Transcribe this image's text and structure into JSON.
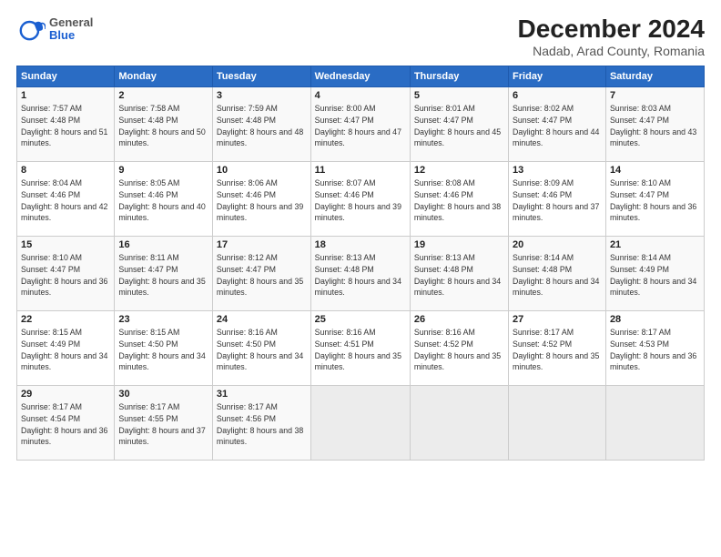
{
  "logo": {
    "general": "General",
    "blue": "Blue"
  },
  "title": "December 2024",
  "subtitle": "Nadab, Arad County, Romania",
  "days_of_week": [
    "Sunday",
    "Monday",
    "Tuesday",
    "Wednesday",
    "Thursday",
    "Friday",
    "Saturday"
  ],
  "weeks": [
    [
      {
        "day": "1",
        "sunrise": "7:57 AM",
        "sunset": "4:48 PM",
        "daylight": "8 hours and 51 minutes."
      },
      {
        "day": "2",
        "sunrise": "7:58 AM",
        "sunset": "4:48 PM",
        "daylight": "8 hours and 50 minutes."
      },
      {
        "day": "3",
        "sunrise": "7:59 AM",
        "sunset": "4:48 PM",
        "daylight": "8 hours and 48 minutes."
      },
      {
        "day": "4",
        "sunrise": "8:00 AM",
        "sunset": "4:47 PM",
        "daylight": "8 hours and 47 minutes."
      },
      {
        "day": "5",
        "sunrise": "8:01 AM",
        "sunset": "4:47 PM",
        "daylight": "8 hours and 45 minutes."
      },
      {
        "day": "6",
        "sunrise": "8:02 AM",
        "sunset": "4:47 PM",
        "daylight": "8 hours and 44 minutes."
      },
      {
        "day": "7",
        "sunrise": "8:03 AM",
        "sunset": "4:47 PM",
        "daylight": "8 hours and 43 minutes."
      }
    ],
    [
      {
        "day": "8",
        "sunrise": "8:04 AM",
        "sunset": "4:46 PM",
        "daylight": "8 hours and 42 minutes."
      },
      {
        "day": "9",
        "sunrise": "8:05 AM",
        "sunset": "4:46 PM",
        "daylight": "8 hours and 40 minutes."
      },
      {
        "day": "10",
        "sunrise": "8:06 AM",
        "sunset": "4:46 PM",
        "daylight": "8 hours and 39 minutes."
      },
      {
        "day": "11",
        "sunrise": "8:07 AM",
        "sunset": "4:46 PM",
        "daylight": "8 hours and 39 minutes."
      },
      {
        "day": "12",
        "sunrise": "8:08 AM",
        "sunset": "4:46 PM",
        "daylight": "8 hours and 38 minutes."
      },
      {
        "day": "13",
        "sunrise": "8:09 AM",
        "sunset": "4:46 PM",
        "daylight": "8 hours and 37 minutes."
      },
      {
        "day": "14",
        "sunrise": "8:10 AM",
        "sunset": "4:47 PM",
        "daylight": "8 hours and 36 minutes."
      }
    ],
    [
      {
        "day": "15",
        "sunrise": "8:10 AM",
        "sunset": "4:47 PM",
        "daylight": "8 hours and 36 minutes."
      },
      {
        "day": "16",
        "sunrise": "8:11 AM",
        "sunset": "4:47 PM",
        "daylight": "8 hours and 35 minutes."
      },
      {
        "day": "17",
        "sunrise": "8:12 AM",
        "sunset": "4:47 PM",
        "daylight": "8 hours and 35 minutes."
      },
      {
        "day": "18",
        "sunrise": "8:13 AM",
        "sunset": "4:48 PM",
        "daylight": "8 hours and 34 minutes."
      },
      {
        "day": "19",
        "sunrise": "8:13 AM",
        "sunset": "4:48 PM",
        "daylight": "8 hours and 34 minutes."
      },
      {
        "day": "20",
        "sunrise": "8:14 AM",
        "sunset": "4:48 PM",
        "daylight": "8 hours and 34 minutes."
      },
      {
        "day": "21",
        "sunrise": "8:14 AM",
        "sunset": "4:49 PM",
        "daylight": "8 hours and 34 minutes."
      }
    ],
    [
      {
        "day": "22",
        "sunrise": "8:15 AM",
        "sunset": "4:49 PM",
        "daylight": "8 hours and 34 minutes."
      },
      {
        "day": "23",
        "sunrise": "8:15 AM",
        "sunset": "4:50 PM",
        "daylight": "8 hours and 34 minutes."
      },
      {
        "day": "24",
        "sunrise": "8:16 AM",
        "sunset": "4:50 PM",
        "daylight": "8 hours and 34 minutes."
      },
      {
        "day": "25",
        "sunrise": "8:16 AM",
        "sunset": "4:51 PM",
        "daylight": "8 hours and 35 minutes."
      },
      {
        "day": "26",
        "sunrise": "8:16 AM",
        "sunset": "4:52 PM",
        "daylight": "8 hours and 35 minutes."
      },
      {
        "day": "27",
        "sunrise": "8:17 AM",
        "sunset": "4:52 PM",
        "daylight": "8 hours and 35 minutes."
      },
      {
        "day": "28",
        "sunrise": "8:17 AM",
        "sunset": "4:53 PM",
        "daylight": "8 hours and 36 minutes."
      }
    ],
    [
      {
        "day": "29",
        "sunrise": "8:17 AM",
        "sunset": "4:54 PM",
        "daylight": "8 hours and 36 minutes."
      },
      {
        "day": "30",
        "sunrise": "8:17 AM",
        "sunset": "4:55 PM",
        "daylight": "8 hours and 37 minutes."
      },
      {
        "day": "31",
        "sunrise": "8:17 AM",
        "sunset": "4:56 PM",
        "daylight": "8 hours and 38 minutes."
      },
      null,
      null,
      null,
      null
    ]
  ]
}
